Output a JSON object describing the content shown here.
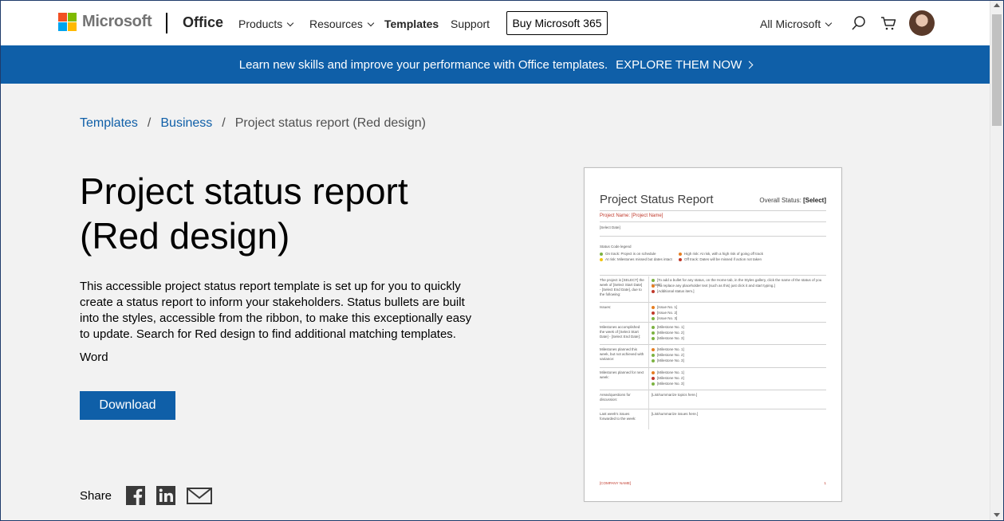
{
  "header": {
    "brand": "Microsoft",
    "product": "Office",
    "nav": [
      {
        "label": "Products",
        "dropdown": true
      },
      {
        "label": "Resources",
        "dropdown": true
      },
      {
        "label": "Templates",
        "dropdown": false
      },
      {
        "label": "Support",
        "dropdown": false
      }
    ],
    "buy_label": "Buy Microsoft 365",
    "all_microsoft": "All Microsoft",
    "icons": [
      "search-icon",
      "cart-icon",
      "avatar"
    ]
  },
  "banner": {
    "text": "Learn new skills and improve your performance with Office templates.",
    "cta": "EXPLORE THEM NOW"
  },
  "breadcrumb": {
    "items": [
      "Templates",
      "Business"
    ],
    "current": "Project status report (Red design)"
  },
  "main": {
    "title": "Project status report (Red design)",
    "description": "This accessible project status report template is set up for you to quickly create a status report to inform your stakeholders. Status bullets are built into the styles, accessible from the ribbon, to make this exceptionally easy to update. Search for Red design to find additional matching templates.",
    "app": "Word",
    "download_label": "Download",
    "share_label": "Share",
    "share_icons": [
      "facebook-icon",
      "linkedin-icon",
      "email-icon"
    ]
  },
  "preview": {
    "title": "Project Status Report",
    "overall_label": "Overall Status:",
    "overall_value": "[Select]",
    "project_name": "Project Name: [Project Name]",
    "date": "[Select Date]",
    "legend_title": "Status Code legend",
    "legend": [
      {
        "text": "On track: Project is on schedule",
        "color": "#7cb342"
      },
      {
        "text": "High risk: At risk, with a high risk of going off track",
        "color": "#e67e22"
      },
      {
        "text": "At risk: Milestones missed but dates intact",
        "color": "#f1c40f"
      },
      {
        "text": "Off track: Dates will be missed if action not taken",
        "color": "#c0392b"
      }
    ],
    "rows": [
      {
        "label": "The project is [SELECT] the week of [Select Start Date] - [Select End Date], due to the following:",
        "items": [
          "[To add a bullet for any status, on the Home tab, in the Styles gallery, click the name of the status of you need.]",
          "[To replace any placeholder text (such as this) just click it and start typing.]",
          "[Additional status item.]"
        ],
        "colors": [
          "#7cb342",
          "#e67e22",
          "#c0392b"
        ]
      },
      {
        "label": "Issues:",
        "items": [
          "[Issue No. 1]",
          "[Issue No. 2]",
          "[Issue No. 3]"
        ],
        "colors": [
          "#e67e22",
          "#c0392b",
          "#7cb342"
        ]
      },
      {
        "label": "Milestones accomplished the week of [Select Start Date] - [Select End Date]:",
        "items": [
          "[Milestone No. 1]",
          "[Milestone No. 2]",
          "[Milestone No. 3]"
        ],
        "colors": [
          "#7cb342",
          "#7cb342",
          "#7cb342"
        ]
      },
      {
        "label": "Milestones planned this week, but not achieved with variance:",
        "items": [
          "[Milestone No. 1]",
          "[Milestone No. 2]",
          "[Milestone No. 3]"
        ],
        "colors": [
          "#e67e22",
          "#7cb342",
          "#7cb342"
        ]
      },
      {
        "label": "Milestones planned for next week:",
        "items": [
          "[Milestone No. 1]",
          "[Milestone No. 2]",
          "[Milestone No. 3]"
        ],
        "colors": [
          "#e67e22",
          "#c0392b",
          "#7cb342"
        ]
      },
      {
        "label": "Areas/questions for discussion:",
        "items": [
          "[List/summarize topics here.]"
        ],
        "colors": []
      },
      {
        "label": "Last week's issues forwarded to the week:",
        "items": [
          "[List/summarize issues here.]"
        ],
        "colors": []
      }
    ],
    "footer": "[COMPANY NAME]",
    "page": "1"
  },
  "colors": {
    "accent": "#0f5fa8",
    "ms_red": "#f25022",
    "ms_green": "#7fba00",
    "ms_blue": "#00a4ef",
    "ms_yellow": "#ffb900"
  }
}
